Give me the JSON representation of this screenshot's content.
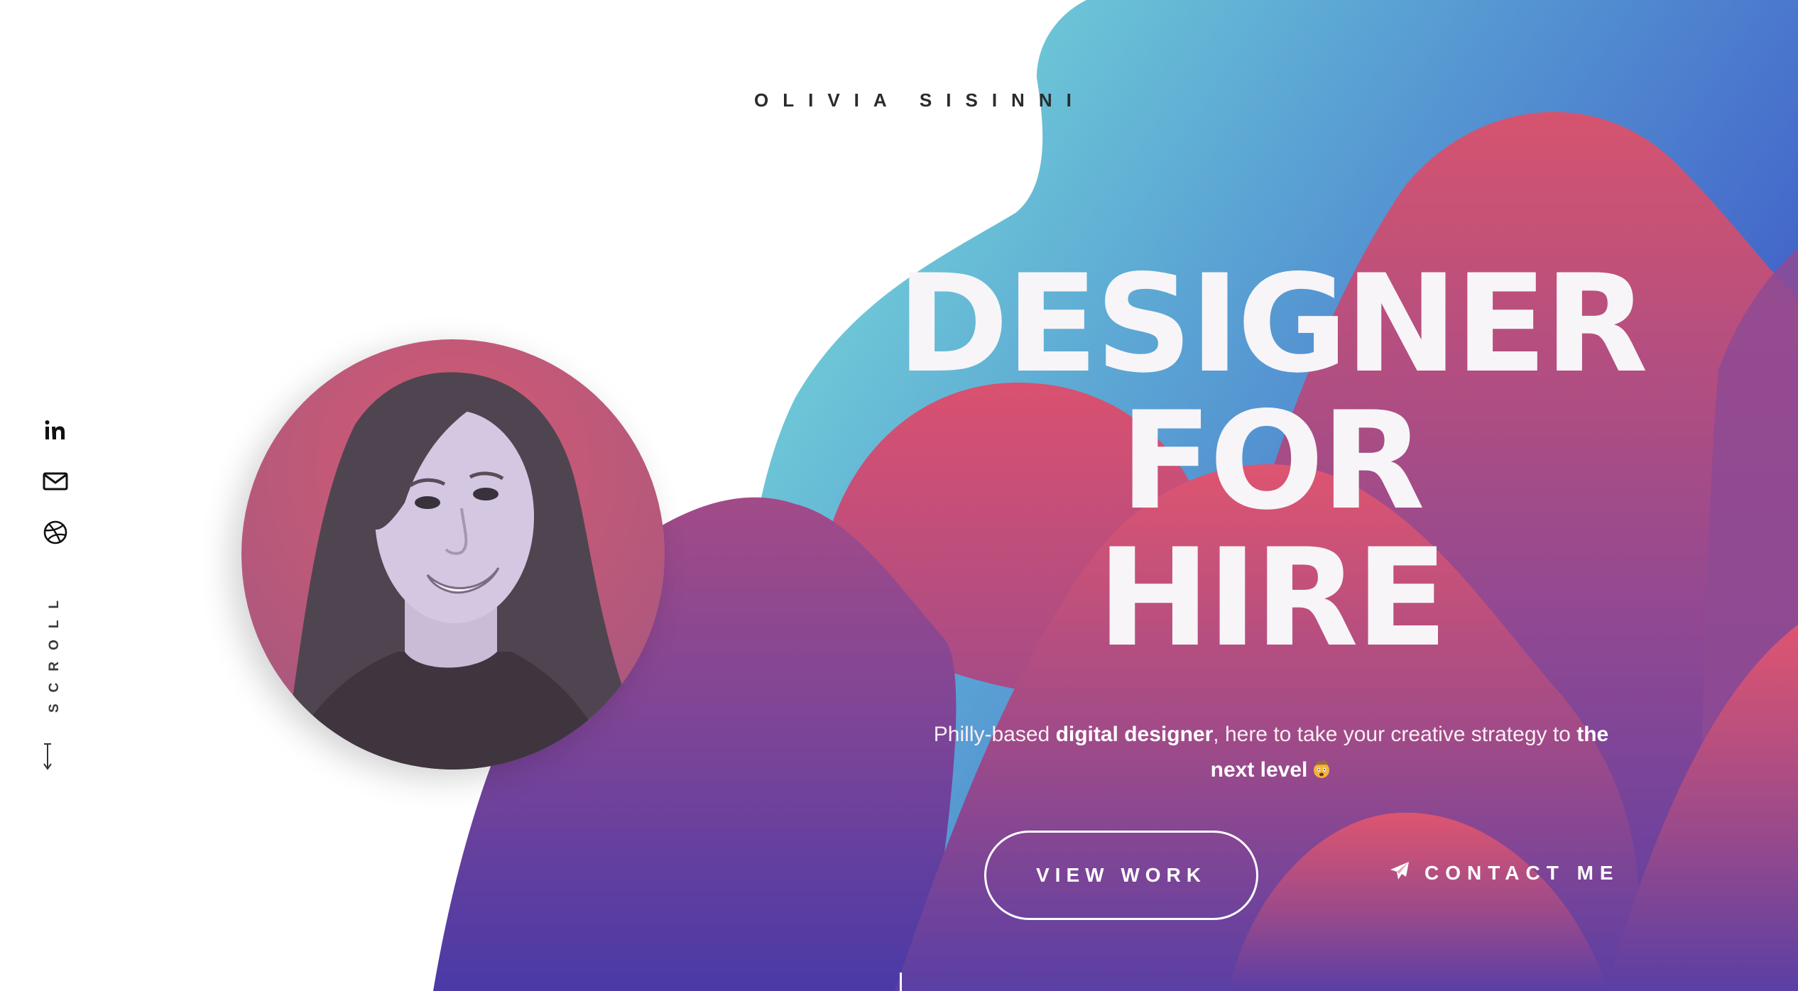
{
  "header": {
    "brand": "OLIVIA SISINNI"
  },
  "social": [
    {
      "icon": "linkedin-icon"
    },
    {
      "icon": "mail-icon"
    },
    {
      "icon": "dribbble-icon"
    }
  ],
  "scroll": {
    "label": "SCROLL",
    "icon": "arrow-down-icon"
  },
  "hero": {
    "headline": [
      "DESIGNER",
      "FOR",
      "HIRE"
    ],
    "tagline": {
      "part1": "Philly-based ",
      "bold1": "digital designer",
      "part2": ", here to take your creative strategy to ",
      "bold2": "the next level",
      "emoji": "exploding-head-emoji"
    },
    "buttons": {
      "view_work": "VIEW WORK",
      "contact": "CONTACT ME",
      "contact_icon": "paper-plane-icon"
    }
  },
  "colors": {
    "teal": "#7fe3d8",
    "blue": "#4a63c9",
    "pink": "#dd5470",
    "purple": "#7d4597",
    "indigo": "#4b3aa6",
    "text_dark": "#2b2b2b"
  }
}
